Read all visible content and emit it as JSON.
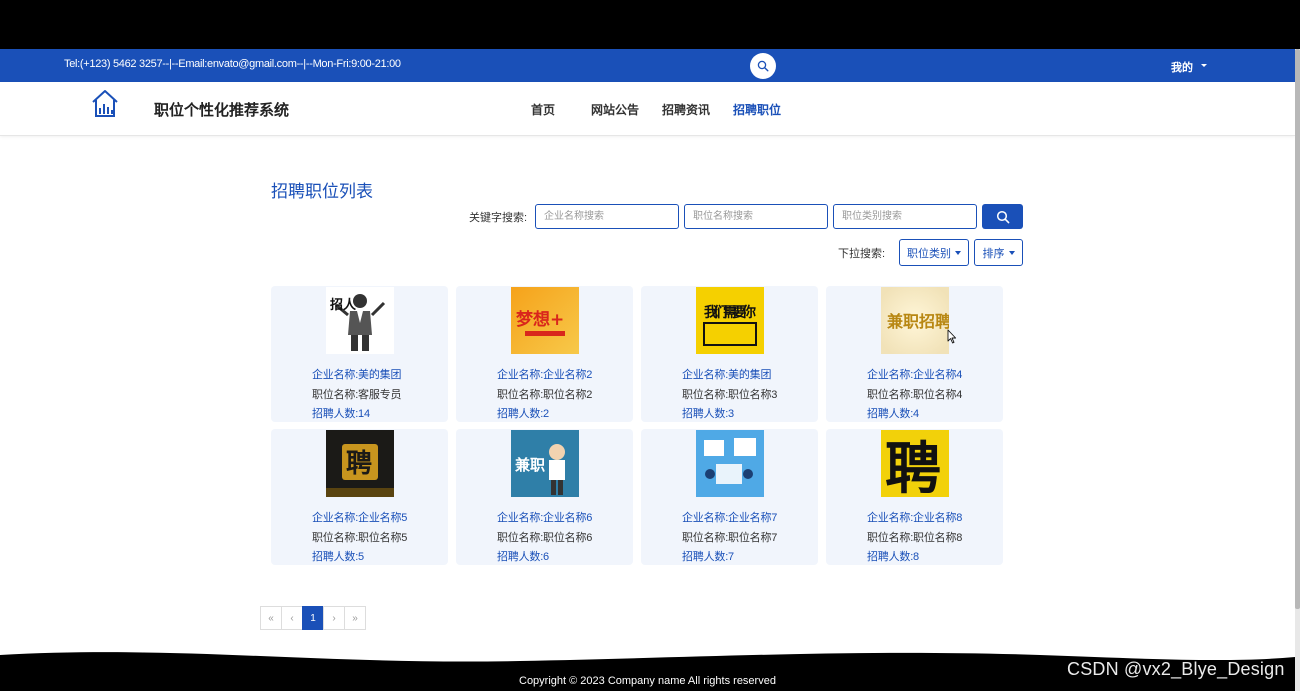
{
  "topbar": {
    "contact": "Tel:(+123) 5462 3257--|--Email:envato@gmail.com--|--Mon-Fri:9:00-21:00",
    "user_menu": "我的"
  },
  "navbar": {
    "site_title": "职位个性化推荐系统",
    "nav": [
      "首页",
      "网站公告",
      "招聘资讯",
      "招聘职位"
    ],
    "active_nav": "招聘职位"
  },
  "main": {
    "title": "招聘职位列表",
    "keyword_label": "关键字搜索:",
    "inputs": [
      {
        "placeholder": "企业名称搜索"
      },
      {
        "placeholder": "职位名称搜索"
      },
      {
        "placeholder": "职位类别搜索"
      }
    ],
    "dropdown_label": "下拉搜索:",
    "dropdowns": [
      "职位类别",
      "排序"
    ]
  },
  "jobs": [
    {
      "company": "企业名称:美的集团",
      "position": "职位名称:客服专员",
      "count": "招聘人数:14",
      "thumb_text": "招人"
    },
    {
      "company": "企业名称:企业名称2",
      "position": "职位名称:职位名称2",
      "count": "招聘人数:2",
      "thumb_text": "梦想+"
    },
    {
      "company": "企业名称:美的集团",
      "position": "职位名称:职位名称3",
      "count": "招聘人数:3",
      "thumb_text": "我们需要你"
    },
    {
      "company": "企业名称:企业名称4",
      "position": "职位名称:职位名称4",
      "count": "招聘人数:4",
      "thumb_text": "兼职招聘"
    },
    {
      "company": "企业名称:企业名称5",
      "position": "职位名称:职位名称5",
      "count": "招聘人数:5",
      "thumb_text": "聘"
    },
    {
      "company": "企业名称:企业名称6",
      "position": "职位名称:职位名称6",
      "count": "招聘人数:6",
      "thumb_text": "兼职"
    },
    {
      "company": "企业名称:企业名称7",
      "position": "职位名称:职位名称7",
      "count": "招聘人数:7",
      "thumb_text": ""
    },
    {
      "company": "企业名称:企业名称8",
      "position": "职位名称:职位名称8",
      "count": "招聘人数:8",
      "thumb_text": "聘"
    }
  ],
  "pagination": {
    "first": "«",
    "prev": "‹",
    "current": "1",
    "next": "›",
    "last": "»"
  },
  "footer": {
    "copyright": "Copyright © 2023 Company name All rights reserved"
  },
  "watermark": "CSDN @vx2_Blye_Design",
  "colors": {
    "primary": "#1a50b8",
    "card_bg": "#f1f5fc"
  }
}
